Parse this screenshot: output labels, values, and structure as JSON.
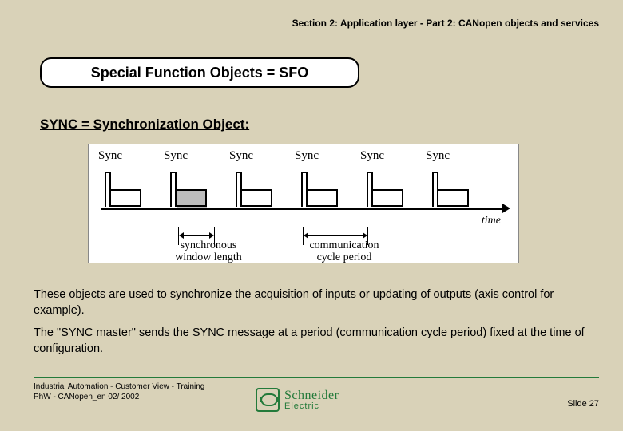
{
  "header": "Section 2: Application layer - Part 2: CANopen objects and services",
  "title_box": "Special Function Objects = SFO",
  "subheading": "SYNC = Synchronization Object:",
  "diagram": {
    "pulse_label": "Sync",
    "time_label": "time",
    "measure1": "synchronous\nwindow length",
    "measure2": "communication\ncycle period"
  },
  "para1": "These objects are used to synchronize the acquisition of inputs or updating of outputs (axis control for example).",
  "para2": "The \"SYNC master\" sends the SYNC message at a period (communication cycle period) fixed at the time of configuration.",
  "footer": {
    "line1": "Industrial Automation -  Customer View - Training",
    "line2": "PhW - CANopen_en  02/ 2002",
    "slide": "Slide 27",
    "logo_top": "Schneider",
    "logo_bottom": "Electric"
  }
}
